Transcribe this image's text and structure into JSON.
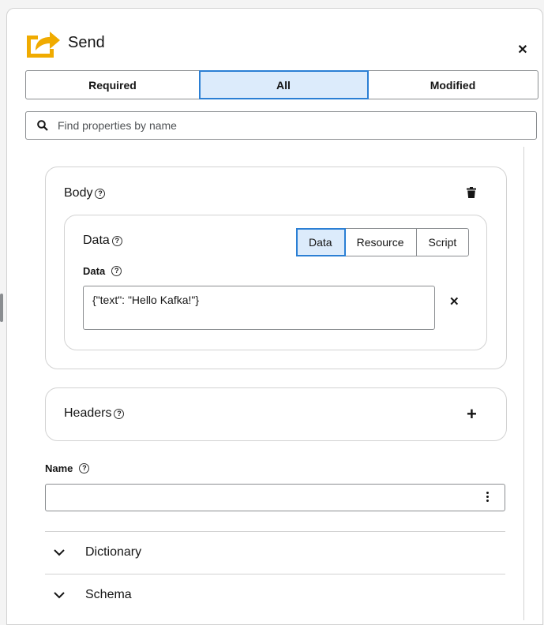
{
  "header": {
    "title": "Send",
    "close_icon": "close-icon"
  },
  "tabs": [
    {
      "label": "Required"
    },
    {
      "label": "All"
    },
    {
      "label": "Modified"
    }
  ],
  "search": {
    "placeholder": "Find properties by name"
  },
  "body_card": {
    "title": "Body",
    "data_card": {
      "title": "Data",
      "types": [
        {
          "label": "Data"
        },
        {
          "label": "Resource"
        },
        {
          "label": "Script"
        }
      ],
      "selected_type": "Data",
      "field_label": "Data",
      "value": "{\"text\": \"Hello Kafka!\"}"
    }
  },
  "headers_card": {
    "title": "Headers"
  },
  "name_field": {
    "label": "Name",
    "value": ""
  },
  "sections": [
    {
      "label": "Dictionary"
    },
    {
      "label": "Schema"
    }
  ],
  "colors": {
    "accent": "#2b7fd4",
    "selected_bg": "#dcebfb",
    "icon_yellow": "#f0ab00"
  }
}
